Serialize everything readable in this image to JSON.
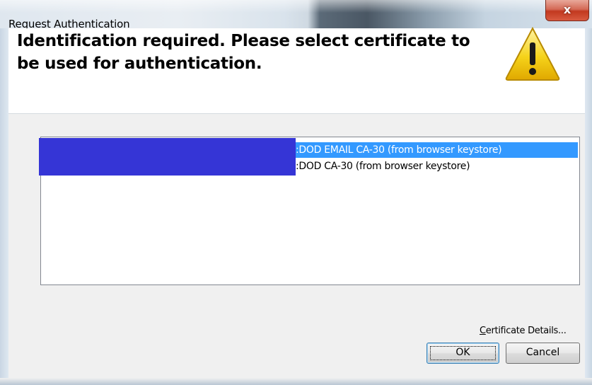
{
  "window": {
    "title": "Request Authentication",
    "close_label": "x"
  },
  "header": {
    "message": "Identification required. Please select certificate to be used for authentication.",
    "icon": "warning-icon",
    "icon_color": "#f5d31a"
  },
  "certificates": {
    "items": [
      {
        "label": ":DOD EMAIL CA-30 (from browser keystore)",
        "selected": true
      },
      {
        "label": ":DOD CA-30 (from browser keystore)",
        "selected": false
      }
    ],
    "selection_color": "#3399ff",
    "redaction_color": "#3535d6"
  },
  "actions": {
    "details_label_accel": "C",
    "details_label_rest": "ertificate Details...",
    "ok_label": "OK",
    "cancel_label": "Cancel"
  }
}
